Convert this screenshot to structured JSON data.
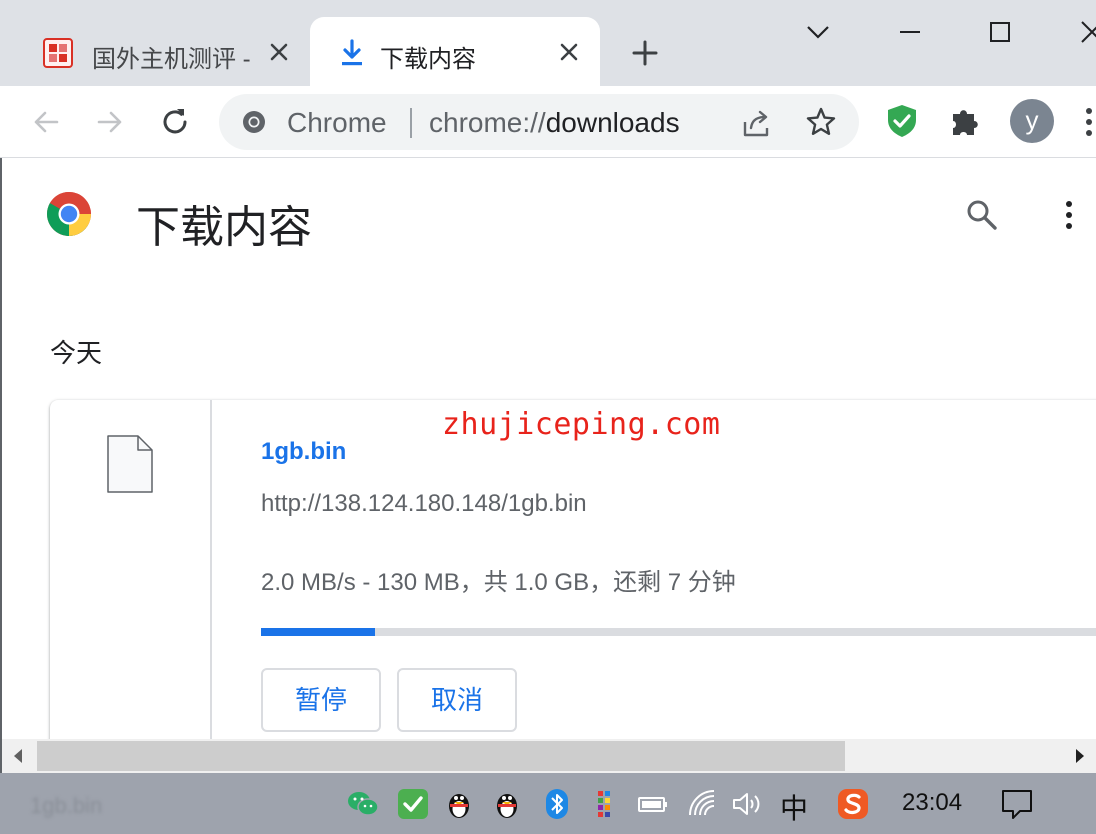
{
  "tabs": [
    {
      "title": "国外主机测评 - ",
      "active": false,
      "favicon": "red-seal-icon"
    },
    {
      "title": "下载内容",
      "active": true,
      "favicon": "download-arrow-icon"
    }
  ],
  "window_controls": [
    "tab-search-chevron",
    "minimize",
    "maximize",
    "close"
  ],
  "toolbar": {
    "site_chip": "Chrome",
    "url_scheme": "chrome://",
    "url_host": "downloads",
    "avatar_letter": "y"
  },
  "page": {
    "title": "下载内容",
    "date_heading": "今天"
  },
  "download": {
    "file_name": "1gb.bin",
    "url": "http://138.124.180.148/1gb.bin",
    "status": "2.0 MB/s - 130 MB，共 1.0 GB，还剩 7 分钟",
    "progress_fraction": 0.13,
    "pause_label": "暂停",
    "cancel_label": "取消"
  },
  "watermark": "zhujiceping.com",
  "taskbar": {
    "ghost_text": "1gb.bin",
    "ime": "中",
    "time": "23:04"
  },
  "colors": {
    "accent": "#1a73e8",
    "watermark": "#e8231b",
    "tabstrip": "#dee1e6",
    "taskbar": "#9ea3ad"
  }
}
